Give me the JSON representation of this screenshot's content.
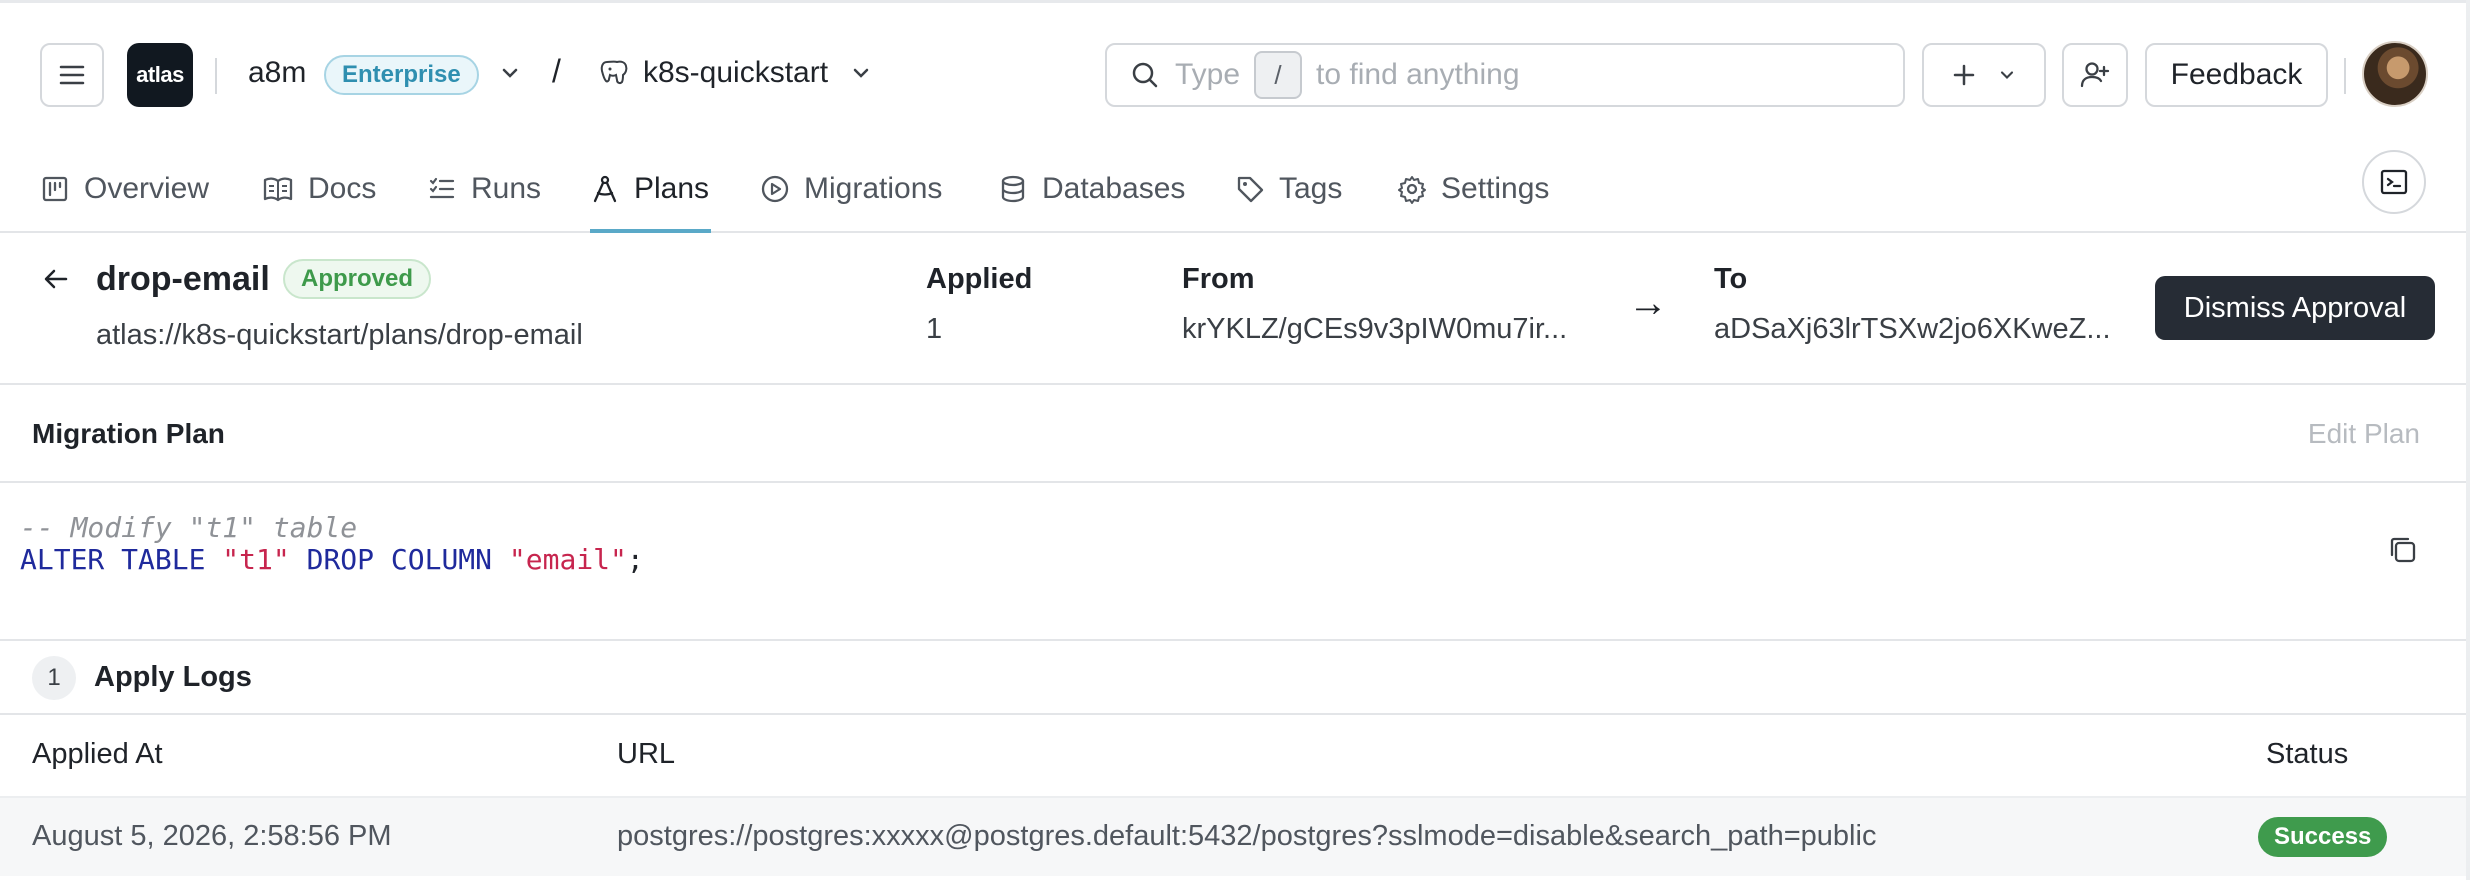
{
  "header": {
    "logo_text": "atlas",
    "org_name": "a8m",
    "plan_badge": "Enterprise",
    "separator": "/",
    "project_name": "k8s-quickstart",
    "search": {
      "before_key": "Type",
      "key": "/",
      "after_key": "to find anything"
    },
    "feedback_label": "Feedback"
  },
  "tabs": [
    {
      "label": "Overview",
      "icon": "overview-icon"
    },
    {
      "label": "Docs",
      "icon": "book-icon"
    },
    {
      "label": "Runs",
      "icon": "list-icon"
    },
    {
      "label": "Plans",
      "icon": "compass-icon",
      "active": true
    },
    {
      "label": "Migrations",
      "icon": "play-circle-icon"
    },
    {
      "label": "Databases",
      "icon": "database-icon"
    },
    {
      "label": "Tags",
      "icon": "tag-icon"
    },
    {
      "label": "Settings",
      "icon": "gear-icon"
    }
  ],
  "plan": {
    "name": "drop-email",
    "status": "Approved",
    "url": "atlas://k8s-quickstart/plans/drop-email",
    "applied_label": "Applied",
    "applied_value": "1",
    "from_label": "From",
    "from_value": "krYKLZ/gCEs9v3pIW0mu7ir...",
    "arrow": "→",
    "to_label": "To",
    "to_value": "aDSaXj63lrTSXw2jo6XKweZ...",
    "dismiss_label": "Dismiss Approval"
  },
  "migration_plan": {
    "title": "Migration Plan",
    "edit_label": "Edit Plan",
    "code": {
      "comment": "-- Modify \"t1\" table",
      "kw1": "ALTER TABLE",
      "table": "\"t1\"",
      "kw2": "DROP COLUMN",
      "column": "\"email\"",
      "terminator": ";"
    }
  },
  "apply_logs": {
    "count": "1",
    "title": "Apply Logs",
    "columns": [
      "Applied At",
      "URL",
      "Status"
    ],
    "rows": [
      {
        "applied_at": "August 5, 2026, 2:58:56 PM",
        "url": "postgres://postgres:xxxxx@postgres.default:5432/postgres?sslmode=disable&search_path=public",
        "status": "Success"
      }
    ]
  },
  "colors": {
    "accent": "#5aa9c8",
    "success": "#3f9b4d",
    "dark_button": "#262c35",
    "enterprise": "#2f8fb0"
  }
}
